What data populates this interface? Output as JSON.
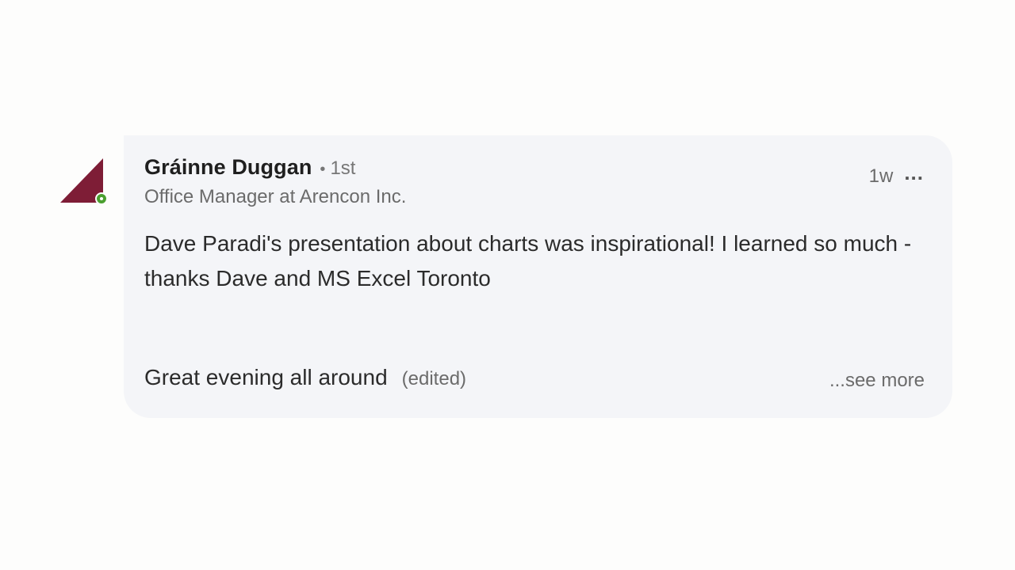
{
  "comment": {
    "author": {
      "name": "Gráinne Duggan",
      "degree_separator": "•",
      "degree": "1st",
      "headline": "Office Manager at Arencon Inc.",
      "avatar_color": "#7e1d36",
      "presence_color": "#4a9f2f",
      "presence": "online"
    },
    "timestamp": "1w",
    "more_options_label": "...",
    "body": "Dave Paradi's presentation about charts was inspirational!  I learned so much - thanks Dave and MS Excel Toronto",
    "footer_line": "Great evening all around",
    "edited_label": "(edited)",
    "see_more_label": "...see more"
  }
}
